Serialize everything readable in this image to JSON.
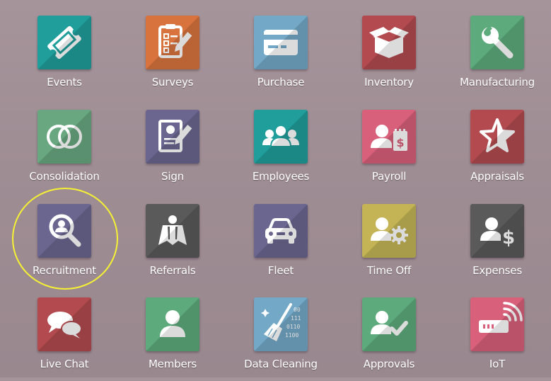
{
  "apps": [
    {
      "label": "Events",
      "icon": "ticket-icon",
      "color": "#1f9e9b"
    },
    {
      "label": "Surveys",
      "icon": "clipboard-checklist-icon",
      "color": "#d9733e"
    },
    {
      "label": "Purchase",
      "icon": "credit-card-icon",
      "color": "#73a9c7"
    },
    {
      "label": "Inventory",
      "icon": "open-box-icon",
      "color": "#b24a4f"
    },
    {
      "label": "Manufacturing",
      "icon": "wrench-icon",
      "color": "#5daa7c"
    },
    {
      "label": "Consolidation",
      "icon": "overlapping-circles-icon",
      "color": "#68a780"
    },
    {
      "label": "Sign",
      "icon": "signed-document-icon",
      "color": "#6a6690"
    },
    {
      "label": "Employees",
      "icon": "group-people-icon",
      "color": "#1f9e9b"
    },
    {
      "label": "Payroll",
      "icon": "person-invoice-icon",
      "color": "#d9607a"
    },
    {
      "label": "Appraisals",
      "icon": "star-icon",
      "color": "#b24a4f"
    },
    {
      "label": "Recruitment",
      "icon": "magnifier-person-icon",
      "color": "#6a6690"
    },
    {
      "label": "Referrals",
      "icon": "superhero-icon",
      "color": "#5a5a5a"
    },
    {
      "label": "Fleet",
      "icon": "car-icon",
      "color": "#6a6690"
    },
    {
      "label": "Time Off",
      "icon": "person-gear-icon",
      "color": "#c4b455"
    },
    {
      "label": "Expenses",
      "icon": "person-dollar-icon",
      "color": "#5a5a5a"
    },
    {
      "label": "Live Chat",
      "icon": "chat-bubbles-icon",
      "color": "#b24a4f"
    },
    {
      "label": "Members",
      "icon": "person-icon",
      "color": "#5daa7c"
    },
    {
      "label": "Data Cleaning",
      "icon": "broom-binary-icon",
      "color": "#73a9c7"
    },
    {
      "label": "Approvals",
      "icon": "person-check-icon",
      "color": "#5daa7c"
    },
    {
      "label": "IoT",
      "icon": "iot-device-icon",
      "color": "#d9607a"
    }
  ],
  "binary_digits": [
    "00",
    "111",
    "0110",
    "1100"
  ],
  "highlight": {
    "target": "Recruitment",
    "color": "#f6f233"
  }
}
